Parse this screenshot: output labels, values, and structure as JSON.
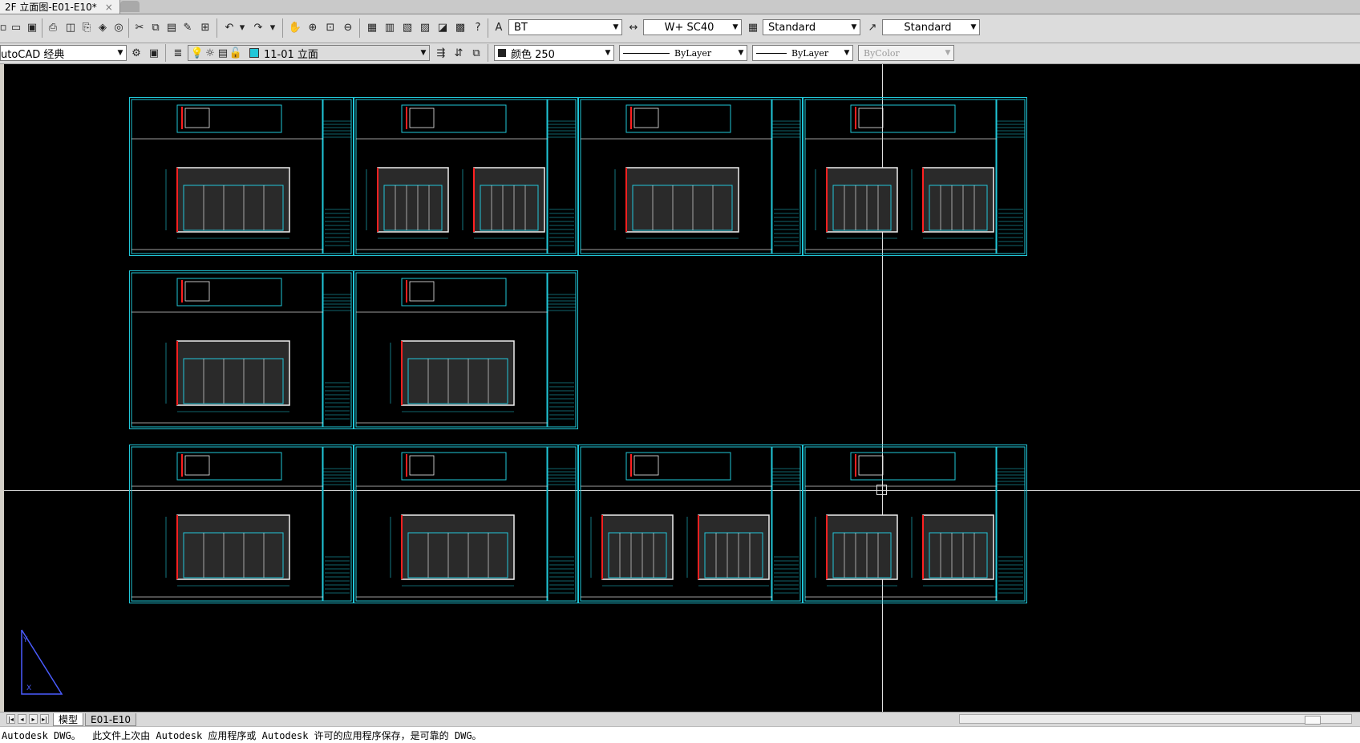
{
  "window": {
    "doc_tab": "2F 立面图-E01-E10*",
    "close_glyph": "×"
  },
  "toolbar1": {
    "text_style": "BT",
    "dim_style": "W+ SC40",
    "table_style": "Standard",
    "mleader_style": "Standard"
  },
  "toolbar2": {
    "workspace": "utoCAD 经典",
    "layer": "11-01 立面",
    "color_label": "颜色 250",
    "linetype": "ByLayer",
    "lineweight": "ByLayer",
    "plotstyle": "ByColor"
  },
  "colors": {
    "canvas": "#000000",
    "sheet_border": "#21c7d9",
    "accent_red": "#ff2020",
    "accent_green": "#23e05a",
    "accent_blue": "#3a5bff"
  },
  "layout_tabs": {
    "model": "模型",
    "layout1": "E01-E10"
  },
  "command_line": "Autodesk DWG。  此文件上次由 Autodesk 应用程序或 Autodesk 许可的应用程序保存，是可靠的 DWG。"
}
